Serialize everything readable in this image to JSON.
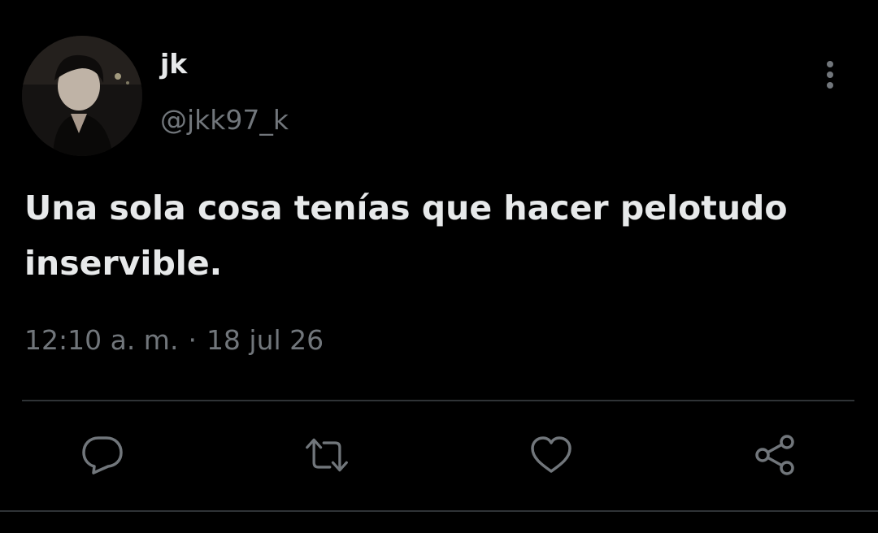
{
  "tweet": {
    "author": {
      "display_name": "jk",
      "handle": "@jkk97_k"
    },
    "text": "Una sola cosa tenías que hacer pelotudo\ninservible.",
    "time": "12:10 a. m.",
    "separator": "·",
    "date": "18 jul 26"
  },
  "icons": {
    "more": "more-vertical-icon",
    "reply": "reply-icon",
    "retweet": "retweet-icon",
    "like": "heart-icon",
    "share": "share-icon"
  },
  "colors": {
    "background": "#000000",
    "text": "#e7e9ea",
    "secondary_text": "#71767b",
    "divider": "#2f3336"
  }
}
